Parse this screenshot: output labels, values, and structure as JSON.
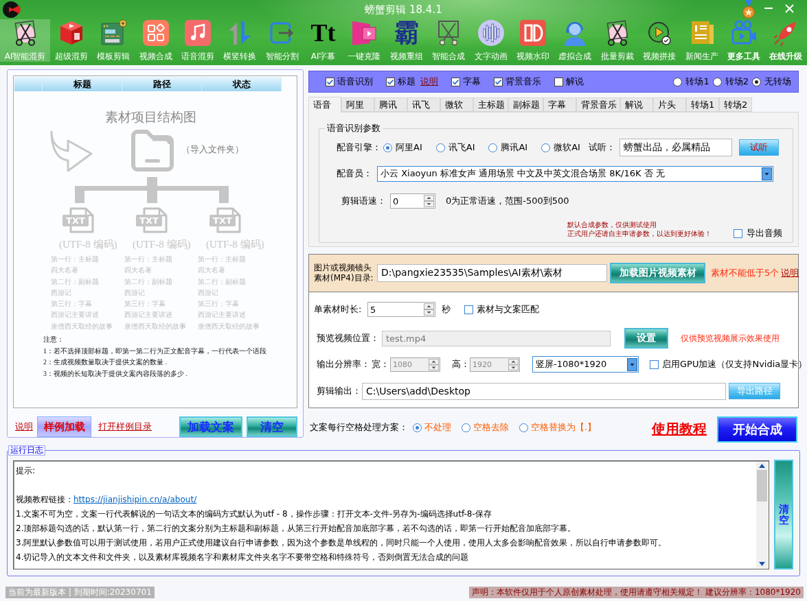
{
  "window": {
    "title": "螃蟹剪辑 18.4.1"
  },
  "toolbar": [
    {
      "label": "AI智能混剪",
      "selected": true,
      "emphasized": false
    },
    {
      "label": "超级混剪",
      "selected": false,
      "emphasized": false
    },
    {
      "label": "模板剪辑",
      "selected": false,
      "emphasized": false
    },
    {
      "label": "视频合成",
      "selected": false,
      "emphasized": false
    },
    {
      "label": "语音混剪",
      "selected": false,
      "emphasized": false
    },
    {
      "label": "横竖转换",
      "selected": false,
      "emphasized": false
    },
    {
      "label": "智能分割",
      "selected": false,
      "emphasized": false
    },
    {
      "label": "AI字幕",
      "glyph": "Tt",
      "selected": false,
      "emphasized": false
    },
    {
      "label": "一键克隆",
      "selected": false,
      "emphasized": false
    },
    {
      "label": "视频重组",
      "glyph": "霸",
      "selected": false,
      "emphasized": false
    },
    {
      "label": "智能合成",
      "selected": false,
      "emphasized": false
    },
    {
      "label": "文字动画",
      "selected": false,
      "emphasized": false
    },
    {
      "label": "视频水印",
      "selected": false,
      "emphasized": false
    },
    {
      "label": "虚拟合成",
      "selected": false,
      "emphasized": false
    },
    {
      "label": "批量剪裁",
      "selected": false,
      "emphasized": false
    },
    {
      "label": "视频拼接",
      "selected": false,
      "emphasized": false
    },
    {
      "label": "新闻生产",
      "selected": false,
      "emphasized": false
    },
    {
      "label": "更多工具",
      "selected": false,
      "emphasized": true
    },
    {
      "label": "在线升级",
      "selected": false,
      "emphasized": true
    }
  ],
  "file_list": {
    "columns": [
      "标题",
      "路径",
      "状态"
    ],
    "diagram": {
      "title": "素材项目结构图",
      "folder_label": "（导入文件夹）",
      "files": [
        {
          "badge": "TXT",
          "encoding": "(UTF-8 编码)",
          "lines": [
            "第一行：主标题",
            "四大名著",
            "第二行：副标题",
            "西游记",
            "第三行：字幕",
            "西游记主要讲述",
            "唐僧西天取经的故事"
          ]
        },
        {
          "badge": "TXT",
          "encoding": "(UTF-8 编码)",
          "lines": [
            "第一行：主标题",
            "四大名著",
            "第二行：副标题",
            "西游记",
            "第三行：字幕",
            "西游记主要讲述",
            "唐僧西天取经的故事"
          ]
        },
        {
          "badge": "TXT",
          "encoding": "(UTF-8 编码)",
          "lines": [
            "第一行：主标题",
            "四大名著",
            "第二行：副标题",
            "西游记",
            "第三行：字幕",
            "西游记主要讲述",
            "唐僧西天取经的故事"
          ]
        }
      ],
      "notes_title": "注意：",
      "notes": [
        "1：若不选择顶部标题，即第一第二行为正文配音字幕，一行代表一个语段",
        "2：生成视频数量取决于提供文案的数量 .",
        "3：视频的长短取决于提供文案内容段落的多少 ."
      ]
    },
    "actions": [
      {
        "kind": "link",
        "label": "说明"
      },
      {
        "kind": "accent",
        "label": "样例加载"
      },
      {
        "kind": "link",
        "label": "打开样例目录"
      },
      {
        "kind": "primary",
        "label": "加载文案"
      },
      {
        "kind": "primary",
        "label": "清空"
      }
    ]
  },
  "options": [
    {
      "label": "语音识别",
      "checked": true
    },
    {
      "label": "标题",
      "checked": true,
      "link": "说明"
    },
    {
      "label": "字幕",
      "checked": true
    },
    {
      "label": "背景音乐",
      "checked": true
    },
    {
      "label": "解说",
      "checked": false
    }
  ],
  "transitions": [
    {
      "label": "转场1",
      "selected": false
    },
    {
      "label": "转场2",
      "selected": false
    },
    {
      "label": "无转场",
      "selected": true
    }
  ],
  "tabs": [
    {
      "label": "语音",
      "selected": true
    },
    {
      "label": "阿里",
      "selected": false
    },
    {
      "label": "腾讯",
      "selected": false
    },
    {
      "label": "讯飞",
      "selected": false
    },
    {
      "label": "微软",
      "selected": false
    },
    {
      "label": "主标题",
      "selected": false
    },
    {
      "label": "副标题",
      "selected": false
    },
    {
      "label": "字幕",
      "selected": false
    },
    {
      "label": "背景音乐",
      "selected": false
    },
    {
      "label": "解说",
      "selected": false
    },
    {
      "label": "片头",
      "selected": false
    },
    {
      "label": "转场1",
      "selected": false
    },
    {
      "label": "转场2",
      "selected": false
    }
  ],
  "voice": {
    "group_title": "语音识别参数",
    "engine_label": "配音引擎：",
    "engines": [
      {
        "label": "阿里AI",
        "selected": true
      },
      {
        "label": "讯飞AI",
        "selected": false
      },
      {
        "label": "腾讯AI",
        "selected": false
      },
      {
        "label": "微软AI",
        "selected": false
      }
    ],
    "preview_label": "试听：",
    "preview_text": "螃蟹出品，必属精品",
    "preview_button": "试听",
    "voice_label": "配音员：",
    "voice": "小云 Xiaoyun 标准女声 通用场景 中文及中英文混合场景 8K/16K 否 无",
    "speed_label": "剪辑语速：",
    "speed": "0",
    "speed_hint": "0为正常语速，范围-500到500",
    "notice": [
      "默认合成参数，仅供测试使用",
      "正式用户还请自主申请参数，以达到更好体验！"
    ],
    "export_audio": {
      "label": "导出音频",
      "checked": false
    }
  },
  "material": {
    "dir_label": [
      "图片或视频镜头",
      "素材(MP4)目录:"
    ],
    "dir": "D:\\pangxie23535\\Samples\\AI素材\\素材",
    "load_button": "加载图片视频素材",
    "warning": "素材不能低于5个",
    "warning_link": "说明",
    "duration_label": "单素材时长:",
    "duration": "5",
    "duration_unit": "秒",
    "match": {
      "label": "素材与文案匹配",
      "checked": false
    },
    "preview": {
      "label": "预览视频位置：",
      "value": "test.mp4",
      "disabled": true
    },
    "settings_button": "设置",
    "preview_note": "仅供预览视频展示效果使用",
    "resolution": {
      "label": "输出分辨率：",
      "width_label": "宽：",
      "width": {
        "value": "1080",
        "disabled": true
      },
      "height_label": "高：",
      "height": {
        "value": "1920",
        "disabled": true
      },
      "preset": "竖屏-1080*1920"
    },
    "gpu": {
      "label": "启用GPU加速（仅支持Nvidia显卡）",
      "checked": false
    },
    "output_label": "剪辑输出：",
    "output": "C:\\Users\\add\\Desktop",
    "output_button": "导出路径"
  },
  "spacing": {
    "label": "文案每行空格处理方案：",
    "options": [
      {
        "label": "不处理",
        "selected": true
      },
      {
        "label": "空格去除",
        "selected": false
      },
      {
        "label": "空格替换为【.】",
        "selected": false
      }
    ]
  },
  "tutorial_link": "使用教程",
  "start_button": "开始合成",
  "log": {
    "title": "运行日志",
    "heading": "提示:",
    "lines": [
      {
        "text": "视频教程链接：",
        "link": "https://jianjishipin.cn/a/about/"
      },
      {
        "text": "1.文案不可为空，文案一行代表解说的一句话文本的编码方式默认为utf - 8，操作步骤：打开文本-文件-另存为-编码选择utf-8-保存"
      },
      {
        "text": "2.顶部标题勾选的话，默认第一行，第二行的文案分别为主标题和副标题，从第三行开始配音加底部字幕，若不勾选的话，即第一行开始配音加底部字幕。"
      },
      {
        "text": "3.阿里默认参数值可以用于测试使用，若用户正式使用建议自行申请参数，因为这个参数是单线程的，同时只能一个人使用，使用人太多会影响配音效果，所以自行申请参数即可。"
      },
      {
        "text": "4.切记导入的文本文件和文件夹，以及素材库视频名字和素材库文件夹名字不要带空格和特殊符号，否则倒置无法合成的问题"
      }
    ],
    "clear_button": "清空"
  },
  "status_bar": {
    "version": "当前为最新版本 | 到期时间:20230701",
    "notice": "声明：本软件仅用于个人原创素材处理，使用请遵守相关规定！ 建议分辨率：1080*1920"
  }
}
